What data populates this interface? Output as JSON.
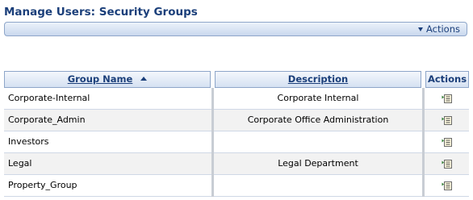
{
  "page": {
    "title": "Manage Users: Security Groups"
  },
  "toolbar": {
    "actions_label": "Actions"
  },
  "table": {
    "columns": {
      "group_name": "Group Name",
      "description": "Description",
      "actions": "Actions"
    },
    "sort": {
      "column": "Group Name",
      "direction": "ascending"
    },
    "rows": [
      {
        "name": "Corporate-Internal",
        "description": "Corporate Internal"
      },
      {
        "name": "Corporate_Admin",
        "description": "Corporate Office Administration"
      },
      {
        "name": "Investors",
        "description": ""
      },
      {
        "name": "Legal",
        "description": "Legal Department"
      },
      {
        "name": "Property_Group",
        "description": ""
      }
    ]
  },
  "colors": {
    "title": "#1b3f7a",
    "border": "#8ea6c9",
    "alt_row": "#f2f2f2",
    "icon_accent": "#2b7a2b"
  },
  "icons": {
    "actions_dropdown": "triangle-down-icon",
    "sort": "sort-ascending-icon",
    "row_action": "row-menu-icon"
  }
}
